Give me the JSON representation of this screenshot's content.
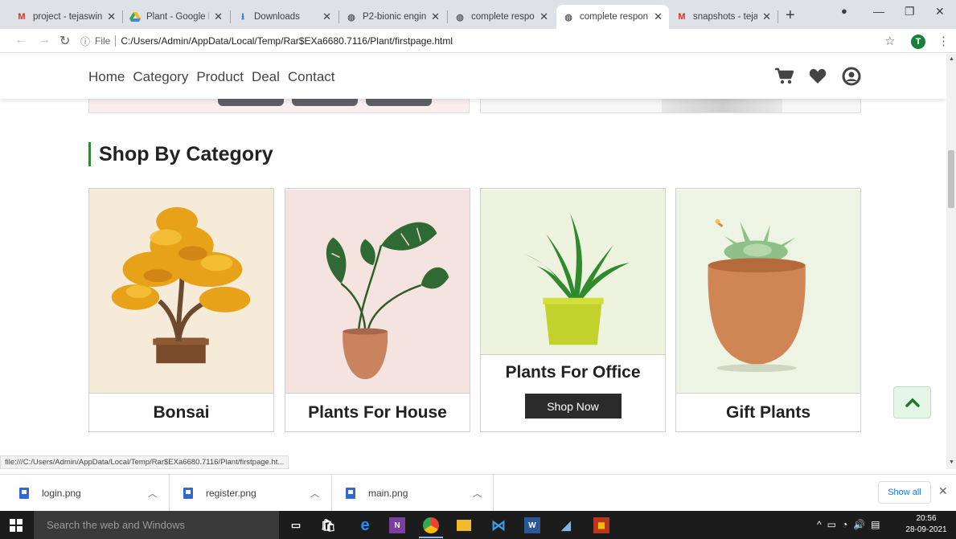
{
  "browser": {
    "tabs": [
      {
        "label": "project - tejaswin",
        "favicon": "gmail-icon",
        "active": false
      },
      {
        "label": "Plant - Google Dr",
        "favicon": "google-drive-icon",
        "active": false
      },
      {
        "label": "Downloads",
        "favicon": "download-icon",
        "active": false
      },
      {
        "label": "P2-bionic engine",
        "favicon": "globe-icon",
        "active": false
      },
      {
        "label": "complete respon",
        "favicon": "globe-icon",
        "active": false
      },
      {
        "label": "complete respon",
        "favicon": "globe-icon",
        "active": true
      },
      {
        "label": "snapshots - tejas",
        "favicon": "gmail-icon",
        "active": false
      }
    ],
    "new_tab": "+",
    "address": {
      "scheme_label": "File",
      "url": "C:/Users/Admin/AppData/Local/Temp/Rar$EXa6680.7116/Plant/firstpage.html"
    },
    "profile_initial": "T"
  },
  "site": {
    "nav": {
      "links": [
        "Home",
        "Category",
        "Product",
        "Deal",
        "Contact"
      ]
    },
    "section_title": "Shop By Category",
    "categories": [
      {
        "title": "Bonsai"
      },
      {
        "title": "Plants For House"
      },
      {
        "title": "Plants For Office",
        "button": "Shop Now"
      },
      {
        "title": "Gift Plants"
      }
    ],
    "accent_color": "#2e8b3a",
    "status_url": "file:///C:/Users/Admin/AppData/Local/Temp/Rar$EXa6680.7116/Plant/firstpage.ht..."
  },
  "downloads": {
    "items": [
      "login.png",
      "register.png",
      "main.png"
    ],
    "show_all": "Show all"
  },
  "taskbar": {
    "search_placeholder": "Search the web and Windows",
    "time": "20:56",
    "date": "28-09-2021"
  }
}
